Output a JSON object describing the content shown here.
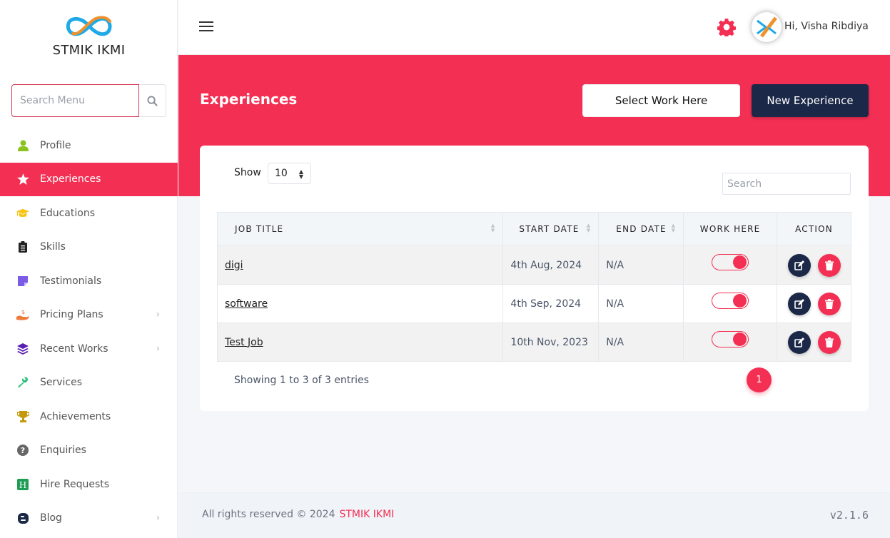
{
  "brand": {
    "name": "STMIK IKMI",
    "logo_icon": "infinity-logo-icon"
  },
  "sidebar": {
    "search_placeholder": "Search Menu",
    "items": [
      {
        "label": "Profile",
        "icon": "user-icon",
        "color": "#8bc21f",
        "has_submenu": false
      },
      {
        "label": "Experiences",
        "icon": "star-icon",
        "color": "#ffffff",
        "active": true,
        "has_submenu": false
      },
      {
        "label": "Educations",
        "icon": "graduation-cap-icon",
        "color": "#f5c518",
        "has_submenu": false
      },
      {
        "label": "Skills",
        "icon": "clipboard-list-icon",
        "color": "#222222",
        "has_submenu": false
      },
      {
        "label": "Testimonials",
        "icon": "sticky-note-icon",
        "color": "#7b5ce6",
        "has_submenu": false
      },
      {
        "label": "Pricing Plans",
        "icon": "hand-dollar-icon",
        "color": "#ee7b3a",
        "has_submenu": true
      },
      {
        "label": "Recent Works",
        "icon": "layers-icon",
        "color": "#5a1fb0",
        "has_submenu": true
      },
      {
        "label": "Services",
        "icon": "wrench-icon",
        "color": "#2ec27e",
        "has_submenu": false
      },
      {
        "label": "Achievements",
        "icon": "trophy-icon",
        "color": "#c29a0c",
        "has_submenu": false
      },
      {
        "label": "Enquiries",
        "icon": "question-circle-icon",
        "color": "#666666",
        "has_submenu": false
      },
      {
        "label": "Hire Requests",
        "icon": "hire-h-icon",
        "color": "#1f9d55",
        "has_submenu": false
      },
      {
        "label": "Blog",
        "icon": "blogger-icon",
        "color": "#1b2847",
        "has_submenu": true
      }
    ]
  },
  "topbar": {
    "greeting": "Hi,  Visha Ribdiya"
  },
  "page": {
    "title": "Experiences",
    "select_work_label": "Select Work Here",
    "new_experience_label": "New Experience"
  },
  "table": {
    "show_label": "Show",
    "page_size": "10",
    "search_placeholder": "Search",
    "columns": [
      "JOB TITLE",
      "START DATE",
      "END DATE",
      "WORK HERE",
      "ACTION"
    ],
    "rows": [
      {
        "job_title": "digi",
        "start_date": "4th Aug, 2024",
        "end_date": "N/A",
        "work_here": true
      },
      {
        "job_title": "software",
        "start_date": "4th Sep, 2024",
        "end_date": "N/A",
        "work_here": true
      },
      {
        "job_title": "Test Job",
        "start_date": "10th Nov, 2023",
        "end_date": "N/A",
        "work_here": true
      }
    ],
    "info": "Showing 1 to 3 of 3 entries",
    "pagination": {
      "prev": "‹",
      "current": "1",
      "next": "›"
    }
  },
  "footer": {
    "copyright": "All rights reserved © 2024",
    "brand": "STMIK IKMI",
    "version": "v2.1.6"
  },
  "colors": {
    "accent": "#f32f53",
    "dark": "#1b2847"
  }
}
